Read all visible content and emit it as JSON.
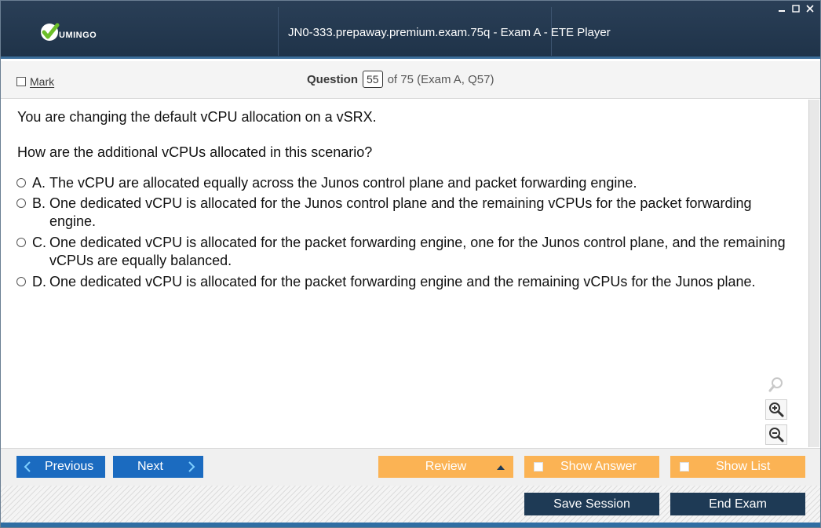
{
  "app": {
    "logo_text": "UMINGO",
    "window_title": "JN0-333.prepaway.premium.exam.75q - Exam A - ETE Player",
    "window_controls": [
      "minimize-icon",
      "maximize-icon",
      "close-icon"
    ]
  },
  "header": {
    "mark_label": "Mark",
    "question_label": "Question",
    "question_number": "55",
    "question_of": "of 75 (Exam A, Q57)"
  },
  "question": {
    "line1": "You are changing the default vCPU allocation on a vSRX.",
    "line2": "How are the additional vCPUs allocated in this scenario?",
    "options": [
      {
        "letter": "A.",
        "text": "The vCPU are allocated equally across the Junos control plane and packet forwarding engine."
      },
      {
        "letter": "B.",
        "text": "One dedicated vCPU is allocated for the Junos control plane and the remaining vCPUs for the packet forwarding engine."
      },
      {
        "letter": "C.",
        "text": "One dedicated vCPU is allocated for the packet forwarding engine, one for the Junos control plane, and the remaining vCPUs are equally balanced."
      },
      {
        "letter": "D.",
        "text": "One dedicated vCPU is allocated for the packet forwarding engine and the remaining vCPUs for the Junos plane."
      }
    ]
  },
  "zoom": {
    "icons": [
      "magnifier-icon",
      "zoom-in-icon",
      "zoom-out-icon"
    ]
  },
  "nav": {
    "previous_label": "Previous",
    "next_label": "Next",
    "review_label": "Review",
    "show_answer_label": "Show Answer",
    "show_list_label": "Show List"
  },
  "footer": {
    "save_session_label": "Save Session",
    "end_exam_label": "End Exam"
  },
  "colors": {
    "title_bar": "#1f3349",
    "accent_blue": "#1b6bc0",
    "accent_orange": "#fbb354",
    "dark_button": "#1e3a55"
  }
}
